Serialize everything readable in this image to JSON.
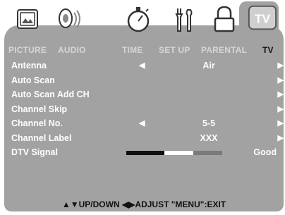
{
  "tabs": [
    {
      "label": "PICTURE",
      "icon": "picture-icon"
    },
    {
      "label": "AUDIO",
      "icon": "speaker-icon"
    },
    {
      "label": "TIME",
      "icon": "stopwatch-icon"
    },
    {
      "label": "SET UP",
      "icon": "tools-icon"
    },
    {
      "label": "PARENTAL",
      "icon": "lock-icon"
    },
    {
      "label": "TV",
      "icon": "tv-icon",
      "active": true
    }
  ],
  "tv_icon_text": "TV",
  "menu": [
    {
      "label": "Antenna",
      "left_arrow": "◀",
      "value": "Air",
      "right_arrow": "▶"
    },
    {
      "label": "Auto Scan",
      "left_arrow": "",
      "value": "",
      "right_arrow": "▶"
    },
    {
      "label": "Auto Scan Add CH",
      "left_arrow": "",
      "value": "",
      "right_arrow": "▶"
    },
    {
      "label": "Channel Skip",
      "left_arrow": "",
      "value": "",
      "right_arrow": "▶"
    },
    {
      "label": "Channel No.",
      "left_arrow": "◀",
      "value": "5-5",
      "right_arrow": "▶"
    },
    {
      "label": "Channel Label",
      "left_arrow": "",
      "value": "XXX",
      "right_arrow": "▶"
    },
    {
      "label": "DTV Signal",
      "signal_status": "Good",
      "signal_segments": [
        0.4,
        0.3,
        0.3
      ]
    }
  ],
  "footer": "▲▼UP/DOWN  ◀▶ADJUST  \"MENU\":EXIT",
  "colors": {
    "panel": "#a2a2a2",
    "text": "#ffffff",
    "inactive_tab": "#d6d6d6",
    "active_tab": "#111111"
  }
}
